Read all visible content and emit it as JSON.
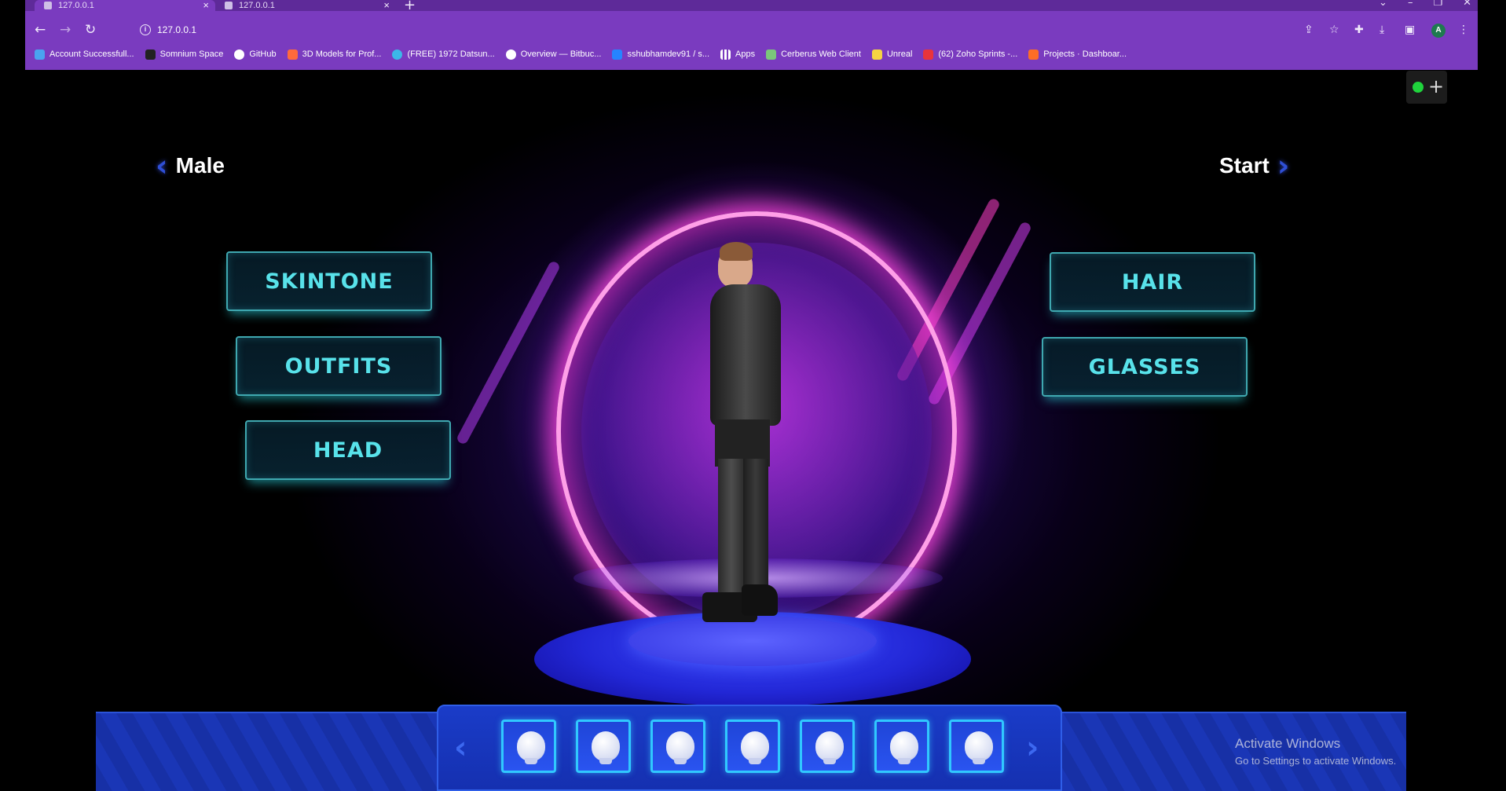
{
  "browser": {
    "tabs": [
      {
        "title": "127.0.0.1",
        "active": true
      },
      {
        "title": "127.0.0.1",
        "active": false
      }
    ],
    "url": "127.0.0.1",
    "profile_initial": "A",
    "bookmarks": [
      {
        "label": "Account Successfull...",
        "icon_color": "#4aa3f0"
      },
      {
        "label": "Somnium Space",
        "icon_color": "#222222"
      },
      {
        "label": "GitHub",
        "icon_color": "#ffffff"
      },
      {
        "label": "3D Models for Prof...",
        "icon_color": "#ff6a3c"
      },
      {
        "label": "(FREE) 1972 Datsun...",
        "icon_color": "#3cb7e8"
      },
      {
        "label": "Overview — Bitbuc...",
        "icon_color": "#ffffff"
      },
      {
        "label": "sshubhamdev91 / s...",
        "icon_color": "#2684ff"
      },
      {
        "label": "Apps",
        "icon_color": "#ffffff"
      },
      {
        "label": "Cerberus Web Client",
        "icon_color": "#7bc67b"
      },
      {
        "label": "Unreal",
        "icon_color": "#f5d442"
      },
      {
        "label": "(62) Zoho Sprints -...",
        "icon_color": "#e8343c"
      },
      {
        "label": "Projects · Dashboar...",
        "icon_color": "#fc6d26"
      }
    ]
  },
  "game": {
    "back_label": "Male",
    "next_label": "Start",
    "menu_left": [
      "SKINTONE",
      "OUTFITS",
      "HEAD"
    ],
    "menu_right": [
      "HAIR",
      "GLASSES"
    ],
    "selector_slots": 7,
    "selector_icon": "head-preset-icon"
  },
  "system": {
    "watermark_title": "Activate Windows",
    "watermark_subtitle": "Go to Settings to activate Windows."
  },
  "colors": {
    "chrome": "#7a3bbf",
    "button_text": "#58e2ea",
    "button_border": "#3fa8b0",
    "portal": "#ff5fe0",
    "platform": "#2a2fe0",
    "status_dot": "#1fd33c"
  }
}
